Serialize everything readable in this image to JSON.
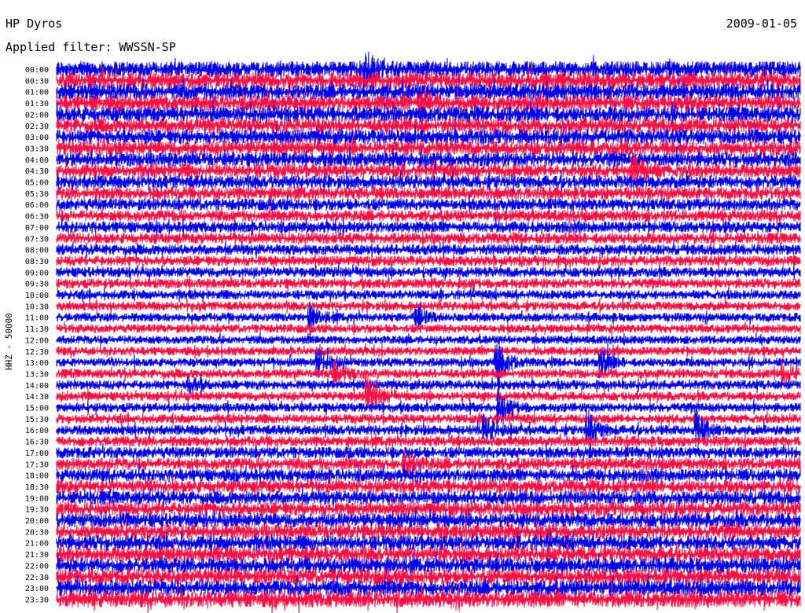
{
  "header": {
    "station": "HP Dyros",
    "date": "2009-01-05",
    "filter_label": "Applied filter: WWSSN-SP"
  },
  "chart_data": {
    "type": "line",
    "title": "HP Dyros",
    "date": "2009-01-05",
    "filter": "WWSSN-SP",
    "ylabel": "HHZ - 50000",
    "colors": [
      "#0000ee",
      "#ff1044"
    ],
    "x_range_minutes": [
      0,
      30
    ],
    "rows": [
      "00:00",
      "00:30",
      "01:00",
      "01:30",
      "02:00",
      "02:30",
      "03:00",
      "03:30",
      "04:00",
      "04:30",
      "05:00",
      "05:30",
      "06:00",
      "06:30",
      "07:00",
      "07:30",
      "08:00",
      "08:30",
      "09:00",
      "09:30",
      "10:00",
      "10:30",
      "11:00",
      "11:30",
      "12:00",
      "12:30",
      "13:00",
      "13:30",
      "14:00",
      "14:30",
      "15:00",
      "15:30",
      "16:00",
      "16:30",
      "17:00",
      "17:30",
      "18:00",
      "18:30",
      "19:00",
      "19:30",
      "20:00",
      "20:30",
      "21:00",
      "21:30",
      "22:00",
      "22:30",
      "23:00",
      "23:30"
    ],
    "noise_level": [
      0.9,
      0.95,
      0.9,
      0.85,
      0.85,
      0.8,
      0.8,
      0.78,
      0.75,
      0.7,
      0.65,
      0.6,
      0.55,
      0.5,
      0.48,
      0.45,
      0.42,
      0.4,
      0.38,
      0.35,
      0.3,
      0.28,
      0.25,
      0.25,
      0.22,
      0.25,
      0.25,
      0.3,
      0.3,
      0.3,
      0.28,
      0.3,
      0.35,
      0.4,
      0.5,
      0.55,
      0.6,
      0.65,
      0.7,
      0.72,
      0.75,
      0.78,
      0.8,
      0.82,
      0.85,
      0.88,
      0.9,
      0.95
    ],
    "events": [
      {
        "row": "00:00",
        "minute": 12.4,
        "amplitude": 2.5
      },
      {
        "row": "01:30",
        "minute": 14.6,
        "amplitude": 2.0
      },
      {
        "row": "04:30",
        "minute": 23.2,
        "amplitude": 3.5
      },
      {
        "row": "11:00",
        "minute": 10.2,
        "amplitude": 1.5
      },
      {
        "row": "11:00",
        "minute": 14.5,
        "amplitude": 1.3
      },
      {
        "row": "13:00",
        "minute": 10.5,
        "amplitude": 2.0
      },
      {
        "row": "13:00",
        "minute": 17.7,
        "amplitude": 3.0
      },
      {
        "row": "13:00",
        "minute": 21.9,
        "amplitude": 2.0
      },
      {
        "row": "13:30",
        "minute": 11.2,
        "amplitude": 2.0
      },
      {
        "row": "13:30",
        "minute": 29.3,
        "amplitude": 1.5
      },
      {
        "row": "14:00",
        "minute": 5.3,
        "amplitude": 1.5
      },
      {
        "row": "14:30",
        "minute": 12.5,
        "amplitude": 3.0
      },
      {
        "row": "15:00",
        "minute": 17.8,
        "amplitude": 2.0
      },
      {
        "row": "16:00",
        "minute": 17.2,
        "amplitude": 2.0
      },
      {
        "row": "16:00",
        "minute": 21.4,
        "amplitude": 2.5
      },
      {
        "row": "16:00",
        "minute": 25.8,
        "amplitude": 2.5
      },
      {
        "row": "17:30",
        "minute": 14.0,
        "amplitude": 2.0
      }
    ]
  }
}
